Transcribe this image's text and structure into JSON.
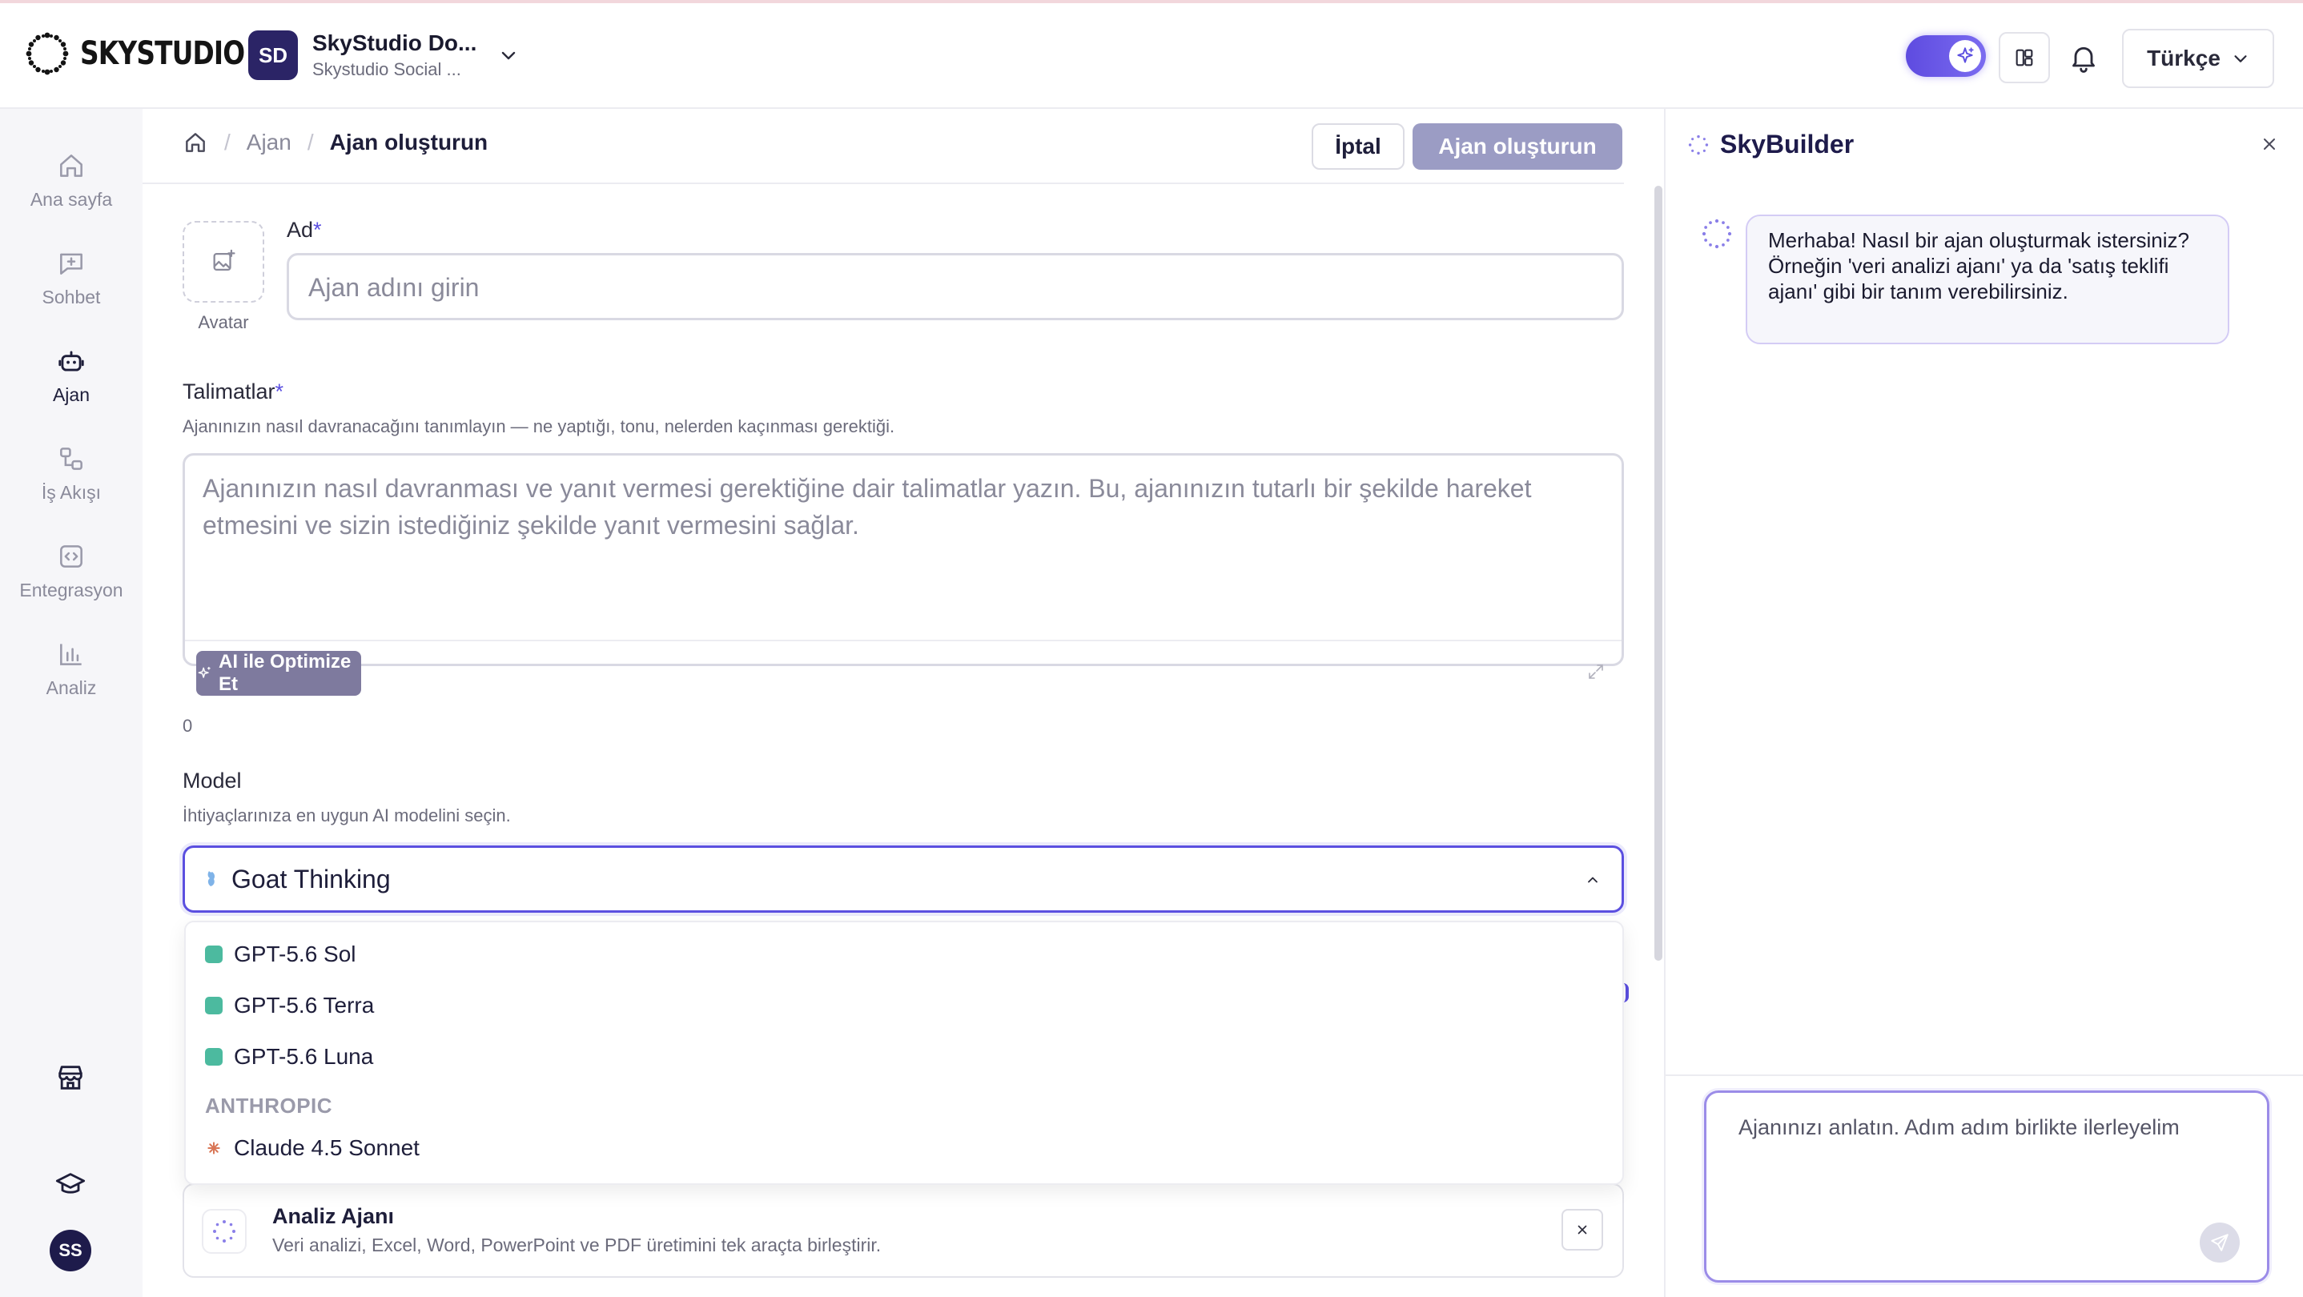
{
  "app": {
    "logo_text": "SKYSTUDIO"
  },
  "workspace": {
    "initials": "SD",
    "title": "SkyStudio Do...",
    "subtitle": "Skystudio Social ..."
  },
  "header": {
    "language": "Türkçe"
  },
  "sidebar": {
    "items": [
      {
        "label": "Ana sayfa",
        "icon": "home-icon"
      },
      {
        "label": "Sohbet",
        "icon": "chat-icon"
      },
      {
        "label": "Ajan",
        "icon": "robot-icon",
        "active": true
      },
      {
        "label": "İş Akışı",
        "icon": "workflow-icon"
      },
      {
        "label": "Entegrasyon",
        "icon": "code-icon"
      },
      {
        "label": "Analiz",
        "icon": "chart-icon"
      }
    ],
    "user_initials": "SS"
  },
  "breadcrumb": {
    "parent": "Ajan",
    "current": "Ajan oluşturun"
  },
  "actions": {
    "cancel": "İptal",
    "create": "Ajan oluşturun"
  },
  "form": {
    "name_label": "Ad",
    "required_mark": "*",
    "name_placeholder": "Ajan adını girin",
    "avatar_label": "Avatar",
    "instructions_label": "Talimatlar",
    "instructions_hint": "Ajanınızın nasıl davranacağını tanımlayın — ne yaptığı, tonu, nelerden kaçınması gerektiği.",
    "instructions_placeholder": "Ajanınızın nasıl davranması ve yanıt vermesi gerektiğine dair talimatlar yazın. Bu, ajanınızın tutarlı bir şekilde hareket etmesini ve sizin istediğiniz şekilde yanıt vermesini sağlar.",
    "optimize_button": "AI ile Optimize Et",
    "char_count": "0",
    "model_label": "Model",
    "model_hint": "İhtiyaçlarınıza en uygun AI modelini seçin.",
    "model_selected": "Goat Thinking"
  },
  "model_dropdown": {
    "items": [
      {
        "label": "GPT-5.6 Sol"
      },
      {
        "label": "GPT-5.6 Terra"
      },
      {
        "label": "GPT-5.6 Luna"
      }
    ],
    "group_anthropic": "ANTHROPIC",
    "anthropic_item": "Claude 4.5 Sonnet"
  },
  "agent_card": {
    "name": "Analiz Ajanı",
    "description": "Veri analizi, Excel, Word, PowerPoint ve PDF üretimini tek araçta birleştirir."
  },
  "panel": {
    "title": "SkyBuilder",
    "greeting": "Merhaba! Nasıl bir ajan oluşturmak istersiniz? Örneğin 'veri analizi ajanı' ya da 'satış teklifi ajanı' gibi bir tanım verebilirsiniz.",
    "input_placeholder": "Ajanınızı anlatın. Adım adım birlikte ilerleyelim"
  },
  "colors": {
    "accent": "#5b4fe0",
    "brand_dark": "#2b2466"
  }
}
